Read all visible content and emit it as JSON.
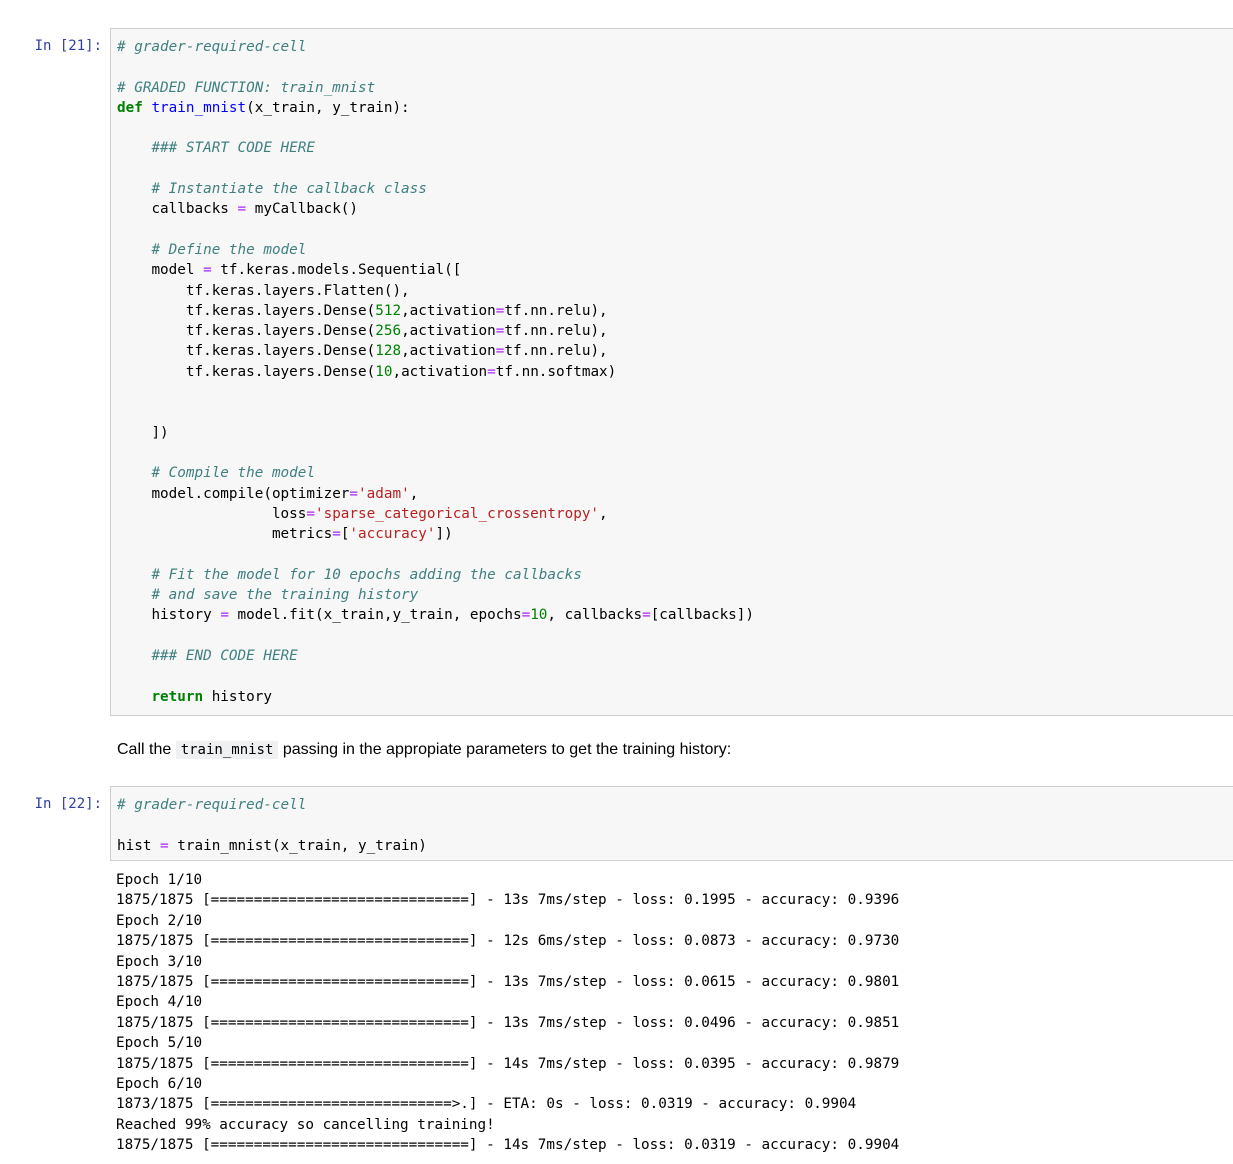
{
  "cell1": {
    "prompt": "In [21]:",
    "lines": {
      "l1": "# grader-required-cell",
      "l3": "# GRADED FUNCTION: train_mnist",
      "l4_kw": "def",
      "l4_fn": "train_mnist",
      "l4_rest": "(x_train, y_train):",
      "l6": "### START CODE HERE",
      "l8": "# Instantiate the callback class",
      "l9a": "callbacks ",
      "l9op": "=",
      "l9b": " myCallback()",
      "l11": "# Define the model",
      "l12a": "model ",
      "l12op": "=",
      "l12b": " tf.keras.models.Sequential([",
      "l13": "tf.keras.layers.Flatten(),",
      "l14a": "tf.keras.layers.Dense(",
      "l14n": "512",
      "l14b": ",activation",
      "l14op": "=",
      "l14c": "tf.nn.relu),",
      "l15a": "tf.keras.layers.Dense(",
      "l15n": "256",
      "l15b": ",activation",
      "l15op": "=",
      "l15c": "tf.nn.relu),",
      "l16a": "tf.keras.layers.Dense(",
      "l16n": "128",
      "l16b": ",activation",
      "l16op": "=",
      "l16c": "tf.nn.relu),",
      "l17a": "tf.keras.layers.Dense(",
      "l17n": "10",
      "l17b": ",activation",
      "l17op": "=",
      "l17c": "tf.nn.softmax)",
      "l20": "])",
      "l22": "# Compile the model",
      "l23a": "model.compile(optimizer",
      "l23op": "=",
      "l23s": "'adam'",
      "l23b": ",",
      "l24a": "loss",
      "l24op": "=",
      "l24s": "'sparse_categorical_crossentropy'",
      "l24b": ",",
      "l25a": "metrics",
      "l25op": "=",
      "l25b": "[",
      "l25s": "'accuracy'",
      "l25c": "])",
      "l27": "# Fit the model for 10 epochs adding the callbacks",
      "l28": "# and save the training history",
      "l29a": "history ",
      "l29op": "=",
      "l29b": " model.fit(x_train,y_train, epochs",
      "l29op2": "=",
      "l29n": "10",
      "l29c": ", callbacks",
      "l29op3": "=",
      "l29d": "[callbacks])",
      "l31": "### END CODE HERE",
      "l33_kw": "return",
      "l33b": " history"
    }
  },
  "markdown": {
    "before": "Call the ",
    "code": "train_mnist",
    "after": " passing in the appropiate parameters to get the training history:"
  },
  "cell2": {
    "prompt": "In [22]:",
    "l1": "# grader-required-cell",
    "l3a": "hist ",
    "l3op": "=",
    "l3b": " train_mnist(x_train, y_train)"
  },
  "output": [
    "Epoch 1/10",
    "1875/1875 [==============================] - 13s 7ms/step - loss: 0.1995 - accuracy: 0.9396",
    "Epoch 2/10",
    "1875/1875 [==============================] - 12s 6ms/step - loss: 0.0873 - accuracy: 0.9730",
    "Epoch 3/10",
    "1875/1875 [==============================] - 13s 7ms/step - loss: 0.0615 - accuracy: 0.9801",
    "Epoch 4/10",
    "1875/1875 [==============================] - 13s 7ms/step - loss: 0.0496 - accuracy: 0.9851",
    "Epoch 5/10",
    "1875/1875 [==============================] - 14s 7ms/step - loss: 0.0395 - accuracy: 0.9879",
    "Epoch 6/10",
    "1873/1875 [============================>.] - ETA: 0s - loss: 0.0319 - accuracy: 0.9904",
    "Reached 99% accuracy so cancelling training!",
    "1875/1875 [==============================] - 14s 7ms/step - loss: 0.0319 - accuracy: 0.9904"
  ]
}
